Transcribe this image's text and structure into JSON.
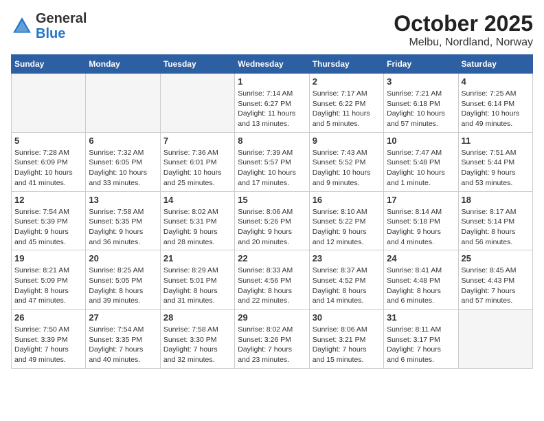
{
  "header": {
    "logo_general": "General",
    "logo_blue": "Blue",
    "month": "October 2025",
    "location": "Melbu, Nordland, Norway"
  },
  "weekdays": [
    "Sunday",
    "Monday",
    "Tuesday",
    "Wednesday",
    "Thursday",
    "Friday",
    "Saturday"
  ],
  "weeks": [
    [
      {
        "day": "",
        "info": ""
      },
      {
        "day": "",
        "info": ""
      },
      {
        "day": "",
        "info": ""
      },
      {
        "day": "1",
        "info": "Sunrise: 7:14 AM\nSunset: 6:27 PM\nDaylight: 11 hours\nand 13 minutes."
      },
      {
        "day": "2",
        "info": "Sunrise: 7:17 AM\nSunset: 6:22 PM\nDaylight: 11 hours\nand 5 minutes."
      },
      {
        "day": "3",
        "info": "Sunrise: 7:21 AM\nSunset: 6:18 PM\nDaylight: 10 hours\nand 57 minutes."
      },
      {
        "day": "4",
        "info": "Sunrise: 7:25 AM\nSunset: 6:14 PM\nDaylight: 10 hours\nand 49 minutes."
      }
    ],
    [
      {
        "day": "5",
        "info": "Sunrise: 7:28 AM\nSunset: 6:09 PM\nDaylight: 10 hours\nand 41 minutes."
      },
      {
        "day": "6",
        "info": "Sunrise: 7:32 AM\nSunset: 6:05 PM\nDaylight: 10 hours\nand 33 minutes."
      },
      {
        "day": "7",
        "info": "Sunrise: 7:36 AM\nSunset: 6:01 PM\nDaylight: 10 hours\nand 25 minutes."
      },
      {
        "day": "8",
        "info": "Sunrise: 7:39 AM\nSunset: 5:57 PM\nDaylight: 10 hours\nand 17 minutes."
      },
      {
        "day": "9",
        "info": "Sunrise: 7:43 AM\nSunset: 5:52 PM\nDaylight: 10 hours\nand 9 minutes."
      },
      {
        "day": "10",
        "info": "Sunrise: 7:47 AM\nSunset: 5:48 PM\nDaylight: 10 hours\nand 1 minute."
      },
      {
        "day": "11",
        "info": "Sunrise: 7:51 AM\nSunset: 5:44 PM\nDaylight: 9 hours\nand 53 minutes."
      }
    ],
    [
      {
        "day": "12",
        "info": "Sunrise: 7:54 AM\nSunset: 5:39 PM\nDaylight: 9 hours\nand 45 minutes."
      },
      {
        "day": "13",
        "info": "Sunrise: 7:58 AM\nSunset: 5:35 PM\nDaylight: 9 hours\nand 36 minutes."
      },
      {
        "day": "14",
        "info": "Sunrise: 8:02 AM\nSunset: 5:31 PM\nDaylight: 9 hours\nand 28 minutes."
      },
      {
        "day": "15",
        "info": "Sunrise: 8:06 AM\nSunset: 5:26 PM\nDaylight: 9 hours\nand 20 minutes."
      },
      {
        "day": "16",
        "info": "Sunrise: 8:10 AM\nSunset: 5:22 PM\nDaylight: 9 hours\nand 12 minutes."
      },
      {
        "day": "17",
        "info": "Sunrise: 8:14 AM\nSunset: 5:18 PM\nDaylight: 9 hours\nand 4 minutes."
      },
      {
        "day": "18",
        "info": "Sunrise: 8:17 AM\nSunset: 5:14 PM\nDaylight: 8 hours\nand 56 minutes."
      }
    ],
    [
      {
        "day": "19",
        "info": "Sunrise: 8:21 AM\nSunset: 5:09 PM\nDaylight: 8 hours\nand 47 minutes."
      },
      {
        "day": "20",
        "info": "Sunrise: 8:25 AM\nSunset: 5:05 PM\nDaylight: 8 hours\nand 39 minutes."
      },
      {
        "day": "21",
        "info": "Sunrise: 8:29 AM\nSunset: 5:01 PM\nDaylight: 8 hours\nand 31 minutes."
      },
      {
        "day": "22",
        "info": "Sunrise: 8:33 AM\nSunset: 4:56 PM\nDaylight: 8 hours\nand 22 minutes."
      },
      {
        "day": "23",
        "info": "Sunrise: 8:37 AM\nSunset: 4:52 PM\nDaylight: 8 hours\nand 14 minutes."
      },
      {
        "day": "24",
        "info": "Sunrise: 8:41 AM\nSunset: 4:48 PM\nDaylight: 8 hours\nand 6 minutes."
      },
      {
        "day": "25",
        "info": "Sunrise: 8:45 AM\nSunset: 4:43 PM\nDaylight: 7 hours\nand 57 minutes."
      }
    ],
    [
      {
        "day": "26",
        "info": "Sunrise: 7:50 AM\nSunset: 3:39 PM\nDaylight: 7 hours\nand 49 minutes."
      },
      {
        "day": "27",
        "info": "Sunrise: 7:54 AM\nSunset: 3:35 PM\nDaylight: 7 hours\nand 40 minutes."
      },
      {
        "day": "28",
        "info": "Sunrise: 7:58 AM\nSunset: 3:30 PM\nDaylight: 7 hours\nand 32 minutes."
      },
      {
        "day": "29",
        "info": "Sunrise: 8:02 AM\nSunset: 3:26 PM\nDaylight: 7 hours\nand 23 minutes."
      },
      {
        "day": "30",
        "info": "Sunrise: 8:06 AM\nSunset: 3:21 PM\nDaylight: 7 hours\nand 15 minutes."
      },
      {
        "day": "31",
        "info": "Sunrise: 8:11 AM\nSunset: 3:17 PM\nDaylight: 7 hours\nand 6 minutes."
      },
      {
        "day": "",
        "info": ""
      }
    ]
  ]
}
